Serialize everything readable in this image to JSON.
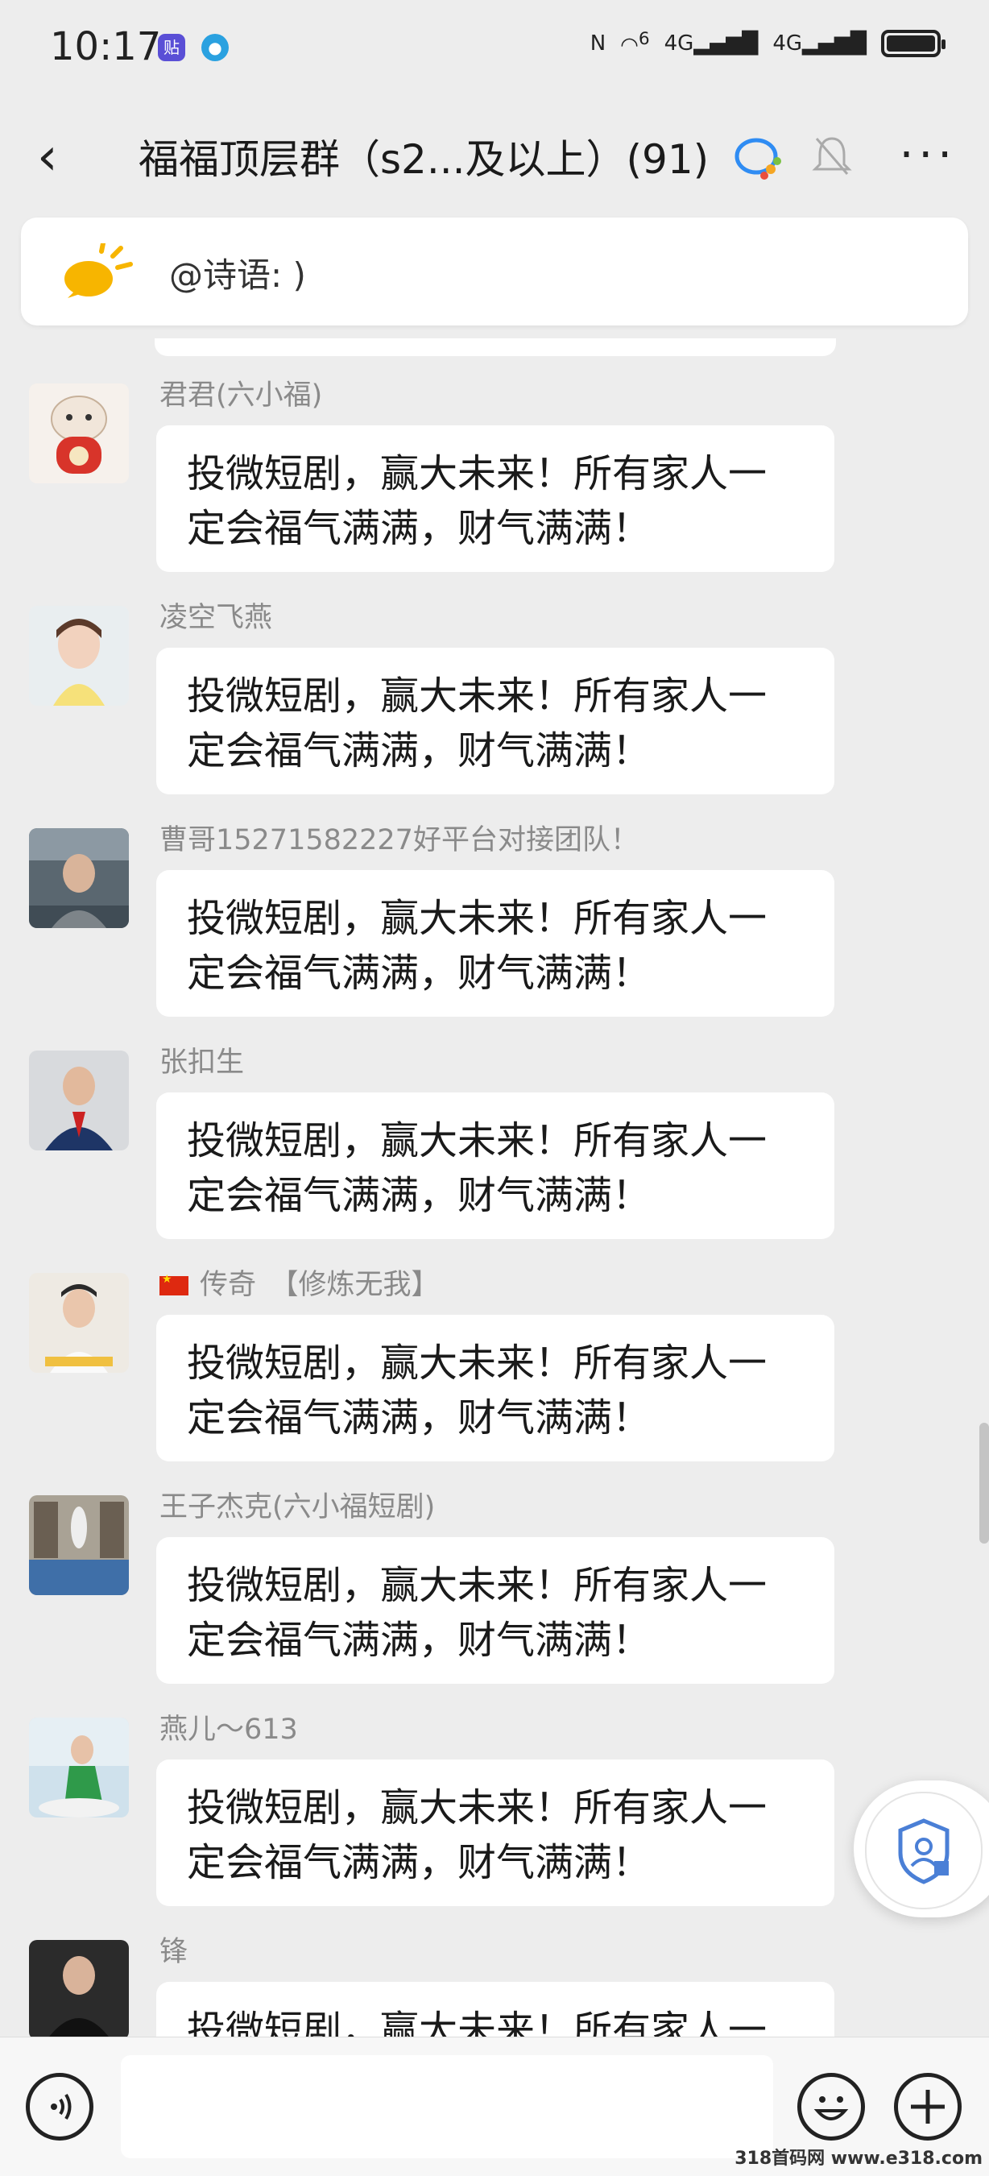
{
  "status": {
    "time": "10:17",
    "signal1": "6",
    "net1": "4G",
    "net2": "4G"
  },
  "header": {
    "title": "福福顶层群（s2...及以上）(91)"
  },
  "mention": {
    "text": "@诗语: )"
  },
  "messages": [
    {
      "sender": "君君(六小福)",
      "text": "投微短剧，赢大未来！所有家人一定会福气满满，财气满满！"
    },
    {
      "sender": "凌空飞燕",
      "text": "投微短剧，赢大未来！所有家人一定会福气满满，财气满满！"
    },
    {
      "sender": "曹哥15271582227好平台对接团队！",
      "text": "投微短剧，赢大未来！所有家人一定会福气满满，财气满满！"
    },
    {
      "sender": "张扣生",
      "text": "投微短剧，赢大未来！所有家人一定会福气满满，财气满满！"
    },
    {
      "sender": "传奇　【修炼无我】",
      "text": "投微短剧，赢大未来！所有家人一定会福气满满，财气满满！"
    },
    {
      "sender": "王子杰克(六小福短剧)",
      "text": "投微短剧，赢大未来！所有家人一定会福气满满，财气满满！"
    },
    {
      "sender": "燕儿～613",
      "text": "投微短剧，赢大未来！所有家人一定会福气满满，财气满满！"
    },
    {
      "sender": "锋",
      "text": "投微短剧，赢大未来！所有家人一定会福气满满，财气满满！"
    }
  ],
  "watermark": "318首码网 www.e318.com"
}
